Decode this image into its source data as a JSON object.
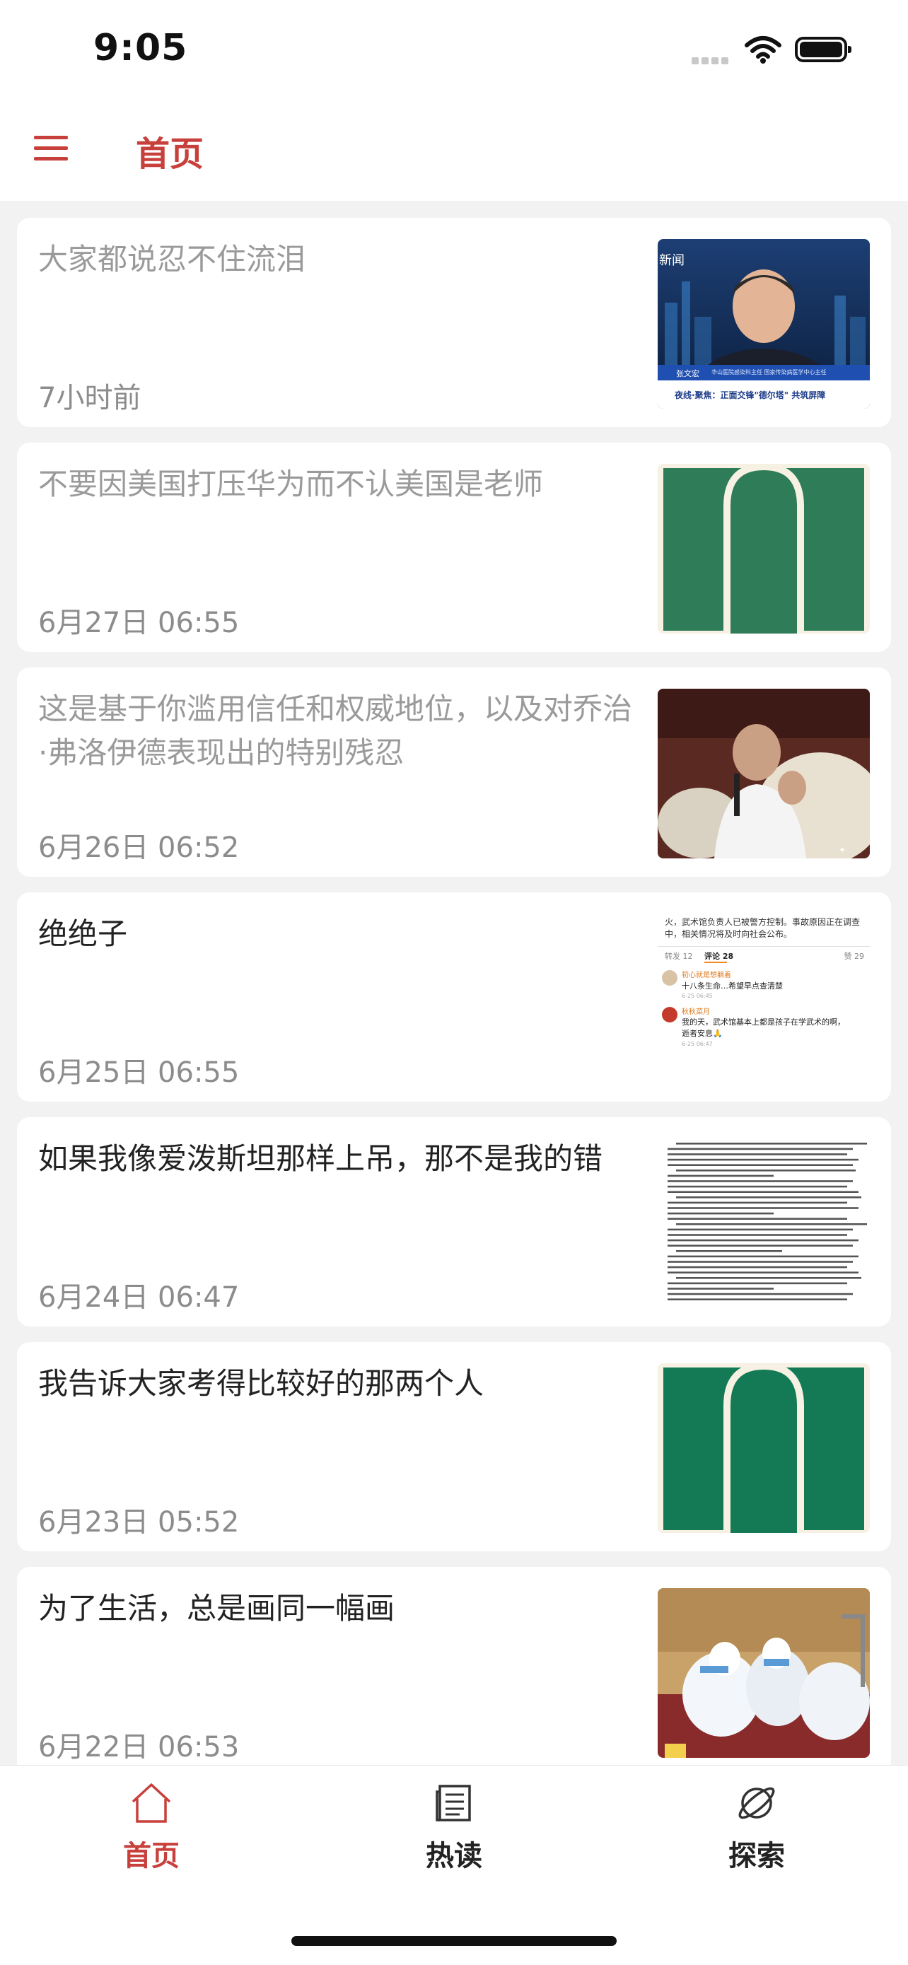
{
  "status": {
    "time": "9:05"
  },
  "header": {
    "title": "首页"
  },
  "feed": [
    {
      "title": "大家都说忍不住流泪",
      "date": "7小时前",
      "read": true
    },
    {
      "title": "不要因美国打压华为而不认美国是老师",
      "date": "6月27日 06:55",
      "read": true
    },
    {
      "title": "这是基于你滥用信任和权威地位，以及对乔治·弗洛伊德表现出的特别残忍",
      "date": "6月26日 06:52",
      "read": true
    },
    {
      "title": "绝绝子",
      "date": "6月25日 06:55",
      "read": false
    },
    {
      "title": "如果我像爱泼斯坦那样上吊，那不是我的错",
      "date": "6月24日 06:47",
      "read": false
    },
    {
      "title": "我告诉大家考得比较好的那两个人",
      "date": "6月23日 05:52",
      "read": false
    },
    {
      "title": "为了生活，总是画同一幅画",
      "date": "6月22日 06:53",
      "read": false
    }
  ],
  "thumbs": {
    "news_corner": "新闻",
    "news_caption": "夜线·聚焦：正面交锋\"德尔塔\" 共筑屏障",
    "news_name": "张文宏",
    "news_sub": "华山医院感染科主任 国家传染病医学中心主任",
    "weibo_text": "火，武术馆负责人已被警方控制。事故原因正在调查中，相关情况将及时向社会公布。",
    "weibo_tabs": [
      "转发 12",
      "评论 28",
      "赞 29"
    ],
    "weibo_c1_user": "初心就是想躺着",
    "weibo_c1_text": "十八条生命…希望早点查清楚",
    "weibo_c1_time": "6-25 06:45",
    "weibo_c2_user": "秋秋菜月",
    "weibo_c2_text": "我的天，武术馆基本上都是孩子在学武术的啊，逝者安息🙏",
    "weibo_c2_time": "6-25 06:47"
  },
  "tabs": [
    {
      "label": "首页",
      "icon": "home-icon",
      "active": true
    },
    {
      "label": "热读",
      "icon": "news-icon",
      "active": false
    },
    {
      "label": "探索",
      "icon": "planet-icon",
      "active": false
    }
  ],
  "colors": {
    "accent": "#c8403c",
    "title_read": "#9a9a9a",
    "title_unread": "#222222",
    "date": "#8c8c8c"
  }
}
